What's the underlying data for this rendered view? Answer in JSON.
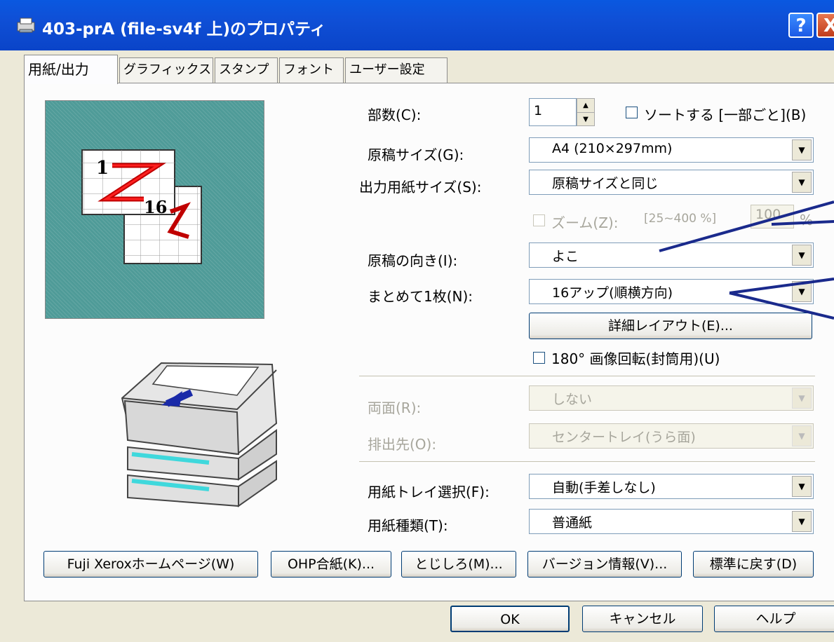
{
  "window": {
    "title": "403-prA (file-sv4f 上)のプロパティ",
    "help_button": "?",
    "close_button": "X"
  },
  "tabs": [
    {
      "label": "用紙/出力",
      "active": true
    },
    {
      "label": "グラフィックス",
      "active": false
    },
    {
      "label": "スタンプ",
      "active": false
    },
    {
      "label": "フォント",
      "active": false
    },
    {
      "label": "ユーザー設定",
      "active": false
    }
  ],
  "preview": {
    "page1_first": "1",
    "page1_last": "16"
  },
  "settings": {
    "copies_label": "部数(C):",
    "copies_value": "1",
    "sort_label": "ソートする [一部ごと](B)",
    "original_size_label": "原稿サイズ(G):",
    "original_size_value": "A4 (210×297mm)",
    "output_size_label": "出力用紙サイズ(S):",
    "output_size_value": "原稿サイズと同じ",
    "zoom_label": "ズーム(Z):",
    "zoom_range": "[25~400 %]",
    "zoom_value": "100",
    "zoom_unit": "%",
    "orientation_label": "原稿の向き(I):",
    "orientation_value": "よこ",
    "nup_label": "まとめて1枚(N):",
    "nup_value": "16アップ(順横方向)",
    "detail_layout_button": "詳細レイアウト(E)...",
    "rotate_label": "180° 画像回転(封筒用)(U)",
    "duplex_label": "両面(R):",
    "duplex_value": "しない",
    "output_dest_label": "排出先(O):",
    "output_dest_value": "センタートレイ(うら面)",
    "tray_label": "用紙トレイ選択(F):",
    "tray_value": "自動(手差しなし)",
    "paper_type_label": "用紙種類(T):",
    "paper_type_value": "普通紙"
  },
  "bottom_buttons": {
    "homepage": "Fuji Xeroxホームページ(W)",
    "ohp": "OHP合紙(K)...",
    "binding": "とじしろ(M)...",
    "version": "バージョン情報(V)...",
    "reset": "標準に戻す(D)"
  },
  "dialog_buttons": {
    "ok": "OK",
    "cancel": "キャンセル",
    "help": "ヘルプ"
  },
  "colors": {
    "titlebar": "#0a58e0",
    "preview_bg": "#4f9b98",
    "annotation_line": "#1a2a8c"
  }
}
